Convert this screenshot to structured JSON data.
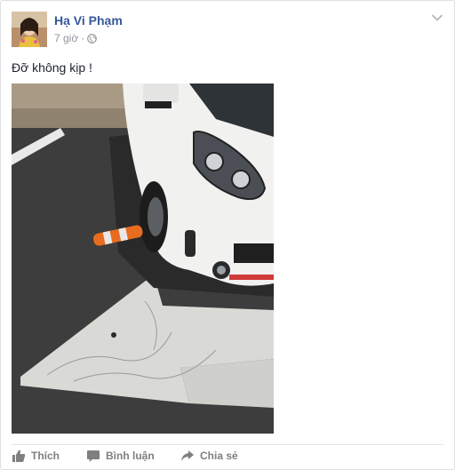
{
  "post": {
    "author": "Hạ Vi Phạm",
    "time": "7 giờ",
    "separator": "·",
    "privacy_icon": "globe-icon",
    "text": "Đỡ không kịp !",
    "menu_icon": "chevron-down-icon"
  },
  "actions": {
    "like_label": "Thích",
    "comment_label": "Bình luận",
    "share_label": "Chia sẻ"
  },
  "colors": {
    "author_link": "#365899",
    "meta_gray": "#90949c",
    "action_gray": "#7f7f7f",
    "border": "#dddfe2"
  }
}
